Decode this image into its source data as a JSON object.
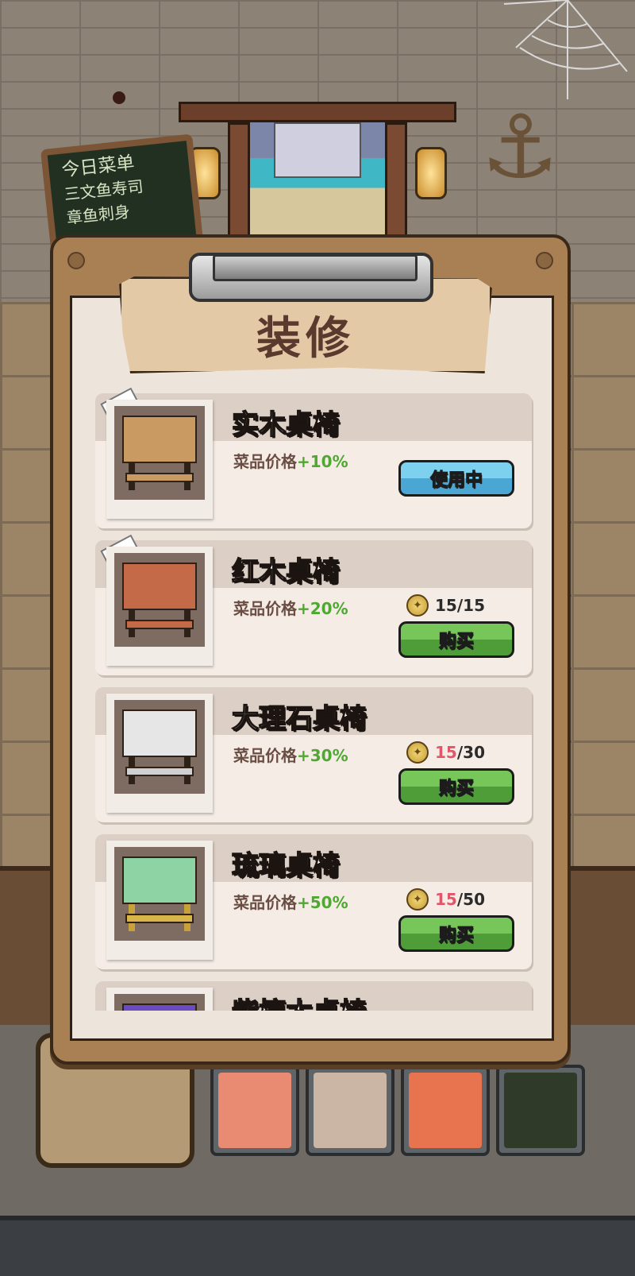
{
  "scene": {
    "menu_board": {
      "title": "今日菜单",
      "lines": [
        "三文鱼寿司",
        "章鱼刺身"
      ]
    }
  },
  "panel": {
    "title": "装修"
  },
  "items": [
    {
      "name": "实木桌椅",
      "effect_label": "菜品价格",
      "bonus": "+10%",
      "status": "使用中",
      "wood_color": "#c99a62"
    },
    {
      "name": "红木桌椅",
      "effect_label": "菜品价格",
      "bonus": "+20%",
      "cost_have": "15",
      "cost_sep": "/",
      "cost_need": "15",
      "button": "购买",
      "wood_color": "#c46a48"
    },
    {
      "name": "大理石桌椅",
      "effect_label": "菜品价格",
      "bonus": "+30%",
      "cost_have": "15",
      "cost_sep": "/",
      "cost_need": "30",
      "button": "购买",
      "wood_color": "#e6e6e6"
    },
    {
      "name": "琉璃桌椅",
      "effect_label": "菜品价格",
      "bonus": "+50%",
      "cost_have": "15",
      "cost_sep": "/",
      "cost_need": "50",
      "button": "购买",
      "wood_color": "#8ed3a4"
    },
    {
      "name": "紫檀木桌椅",
      "wood_color": "#6a4cc0"
    }
  ],
  "colors": {
    "bonus_green": "#4ea832",
    "cost_low_red": "#e0566a",
    "inuse_blue": "#5ab8e0",
    "buy_green": "#5cae42"
  }
}
